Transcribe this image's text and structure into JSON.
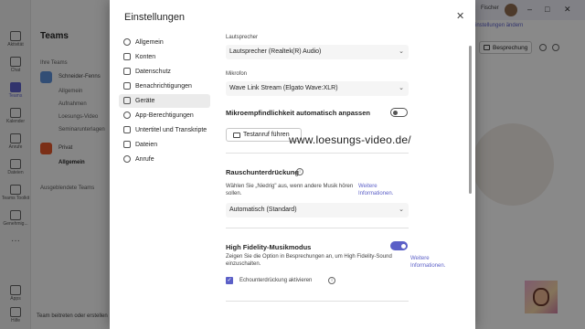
{
  "background": {
    "rail": [
      {
        "label": "Aktivität",
        "active": false
      },
      {
        "label": "Chat",
        "active": false
      },
      {
        "label": "Teams",
        "active": true
      },
      {
        "label": "Kalender",
        "active": false
      },
      {
        "label": "Anrufe",
        "active": false
      },
      {
        "label": "Dateien",
        "active": false
      },
      {
        "label": "Teams Toolkit",
        "active": false
      },
      {
        "label": "Genehmig...",
        "active": false
      }
    ],
    "rail_bottom": [
      "Apps",
      "Hilfe"
    ],
    "teams_title": "Teams",
    "your_teams": "Ihre Teams",
    "team1_name": "Schneider-Fenns",
    "team1_channels": [
      "Allgemein",
      "Aufnahmen",
      "Loesungs-Video",
      "Seminarunterlagen"
    ],
    "team2_name": "Privat",
    "team2_channel": "Allgemein",
    "hidden_teams": "Ausgeblendete Teams",
    "join_team": "Team beitreten oder erstellen",
    "user_name": "Fischer",
    "notification": "Einstellungen ändern",
    "meeting_button": "Besprechung"
  },
  "dialog": {
    "title": "Einstellungen",
    "close_icon": "close-icon",
    "nav": [
      {
        "label": "Allgemein",
        "icon": "gear-icon",
        "active": false
      },
      {
        "label": "Konten",
        "icon": "account-icon",
        "active": false
      },
      {
        "label": "Datenschutz",
        "icon": "lock-icon",
        "active": false
      },
      {
        "label": "Benachrichtigungen",
        "icon": "bell-icon",
        "active": false
      },
      {
        "label": "Geräte",
        "icon": "device-icon",
        "active": true
      },
      {
        "label": "App-Berechtigungen",
        "icon": "shield-icon",
        "active": false
      },
      {
        "label": "Untertitel und Transkripte",
        "icon": "cc-icon",
        "active": false
      },
      {
        "label": "Dateien",
        "icon": "file-icon",
        "active": false
      },
      {
        "label": "Anrufe",
        "icon": "phone-icon",
        "active": false
      }
    ],
    "speaker_label": "Lautsprecher",
    "speaker_value": "Lautsprecher (Realtek(R) Audio)",
    "mic_label": "Mikrofon",
    "mic_value": "Wave Link Stream (Elgato Wave:XLR)",
    "auto_sensitivity_label": "Mikroempfindlichkeit automatisch anpassen",
    "auto_sensitivity_on": false,
    "test_call_button": "Testanruf führen",
    "watermark": "www.loesungs-video.de/",
    "noise_title": "Rauschunterdrückung",
    "noise_desc": "Wählen Sie „Niedrig\" aus, wenn andere Musik hören sollen.",
    "noise_more_info": "Weitere Informationen.",
    "noise_value": "Automatisch (Standard)",
    "hifi_title": "High Fidelity-Musikmodus",
    "hifi_on": true,
    "hifi_desc": "Zeigen Sie die Option in Besprechungen an, um High Fidelity-Sound einzuschalten.",
    "hifi_more_info": "Weitere Informationen.",
    "echo_label": "Echounterdrückung aktivieren",
    "echo_checked": true,
    "accent_color": "#5b5fc7"
  }
}
